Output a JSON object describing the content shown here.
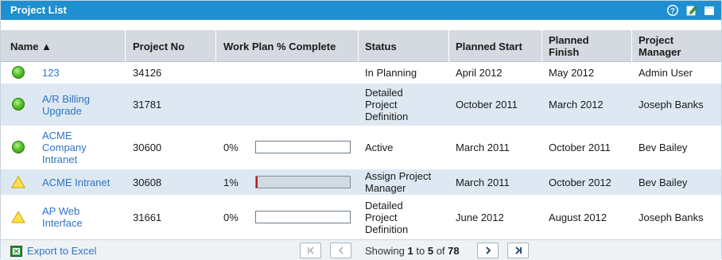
{
  "portlet": {
    "title": "Project List",
    "icons": [
      "help-icon",
      "edit-icon",
      "maximize-icon"
    ]
  },
  "columns": {
    "name": "Name ▲",
    "project_no": "Project No",
    "work_plan": "Work Plan % Complete",
    "status": "Status",
    "planned_start": "Planned Start",
    "planned_finish": "Planned Finish",
    "project_manager": "Project Manager"
  },
  "rows": [
    {
      "indicator": "green",
      "name": "123",
      "project_no": "34126",
      "percent_label": "",
      "percent": null,
      "status": "In Planning",
      "planned_start": "April 2012",
      "planned_finish": "May 2012",
      "project_manager": "Admin User"
    },
    {
      "indicator": "green",
      "name": "A/R Billing Upgrade",
      "project_no": "31781",
      "percent_label": "",
      "percent": null,
      "status": "Detailed Project Definition",
      "planned_start": "October 2011",
      "planned_finish": "March 2012",
      "project_manager": "Joseph Banks"
    },
    {
      "indicator": "green",
      "name": "ACME Company Intranet",
      "project_no": "30600",
      "percent_label": "0%",
      "percent": 0,
      "status": "Active",
      "planned_start": "March 2011",
      "planned_finish": "October 2011",
      "project_manager": "Bev Bailey"
    },
    {
      "indicator": "yellow",
      "name": "ACME Intranet",
      "project_no": "30608",
      "percent_label": "1%",
      "percent": 1,
      "status": "Assign Project Manager",
      "planned_start": "March 2011",
      "planned_finish": "October 2012",
      "project_manager": "Bev Bailey"
    },
    {
      "indicator": "yellow",
      "name": "AP Web Interface",
      "project_no": "31661",
      "percent_label": "0%",
      "percent": 0,
      "status": "Detailed Project Definition",
      "planned_start": "June 2012",
      "planned_finish": "August 2012",
      "project_manager": "Joseph Banks"
    }
  ],
  "footer": {
    "export_label": "Export to Excel",
    "showing_prefix": "Showing",
    "range_start": "1",
    "range_to": "to",
    "range_end": "5",
    "range_of": "of",
    "total": "78",
    "buttons": [
      "first-page",
      "previous-page",
      "next-page",
      "last-page"
    ]
  },
  "colors": {
    "titlebar": "#1e8fd0",
    "header": "#d4dadf",
    "alt_row": "#dde8f2",
    "link": "#2f74c7",
    "progress_fill": "#b21f1f"
  }
}
